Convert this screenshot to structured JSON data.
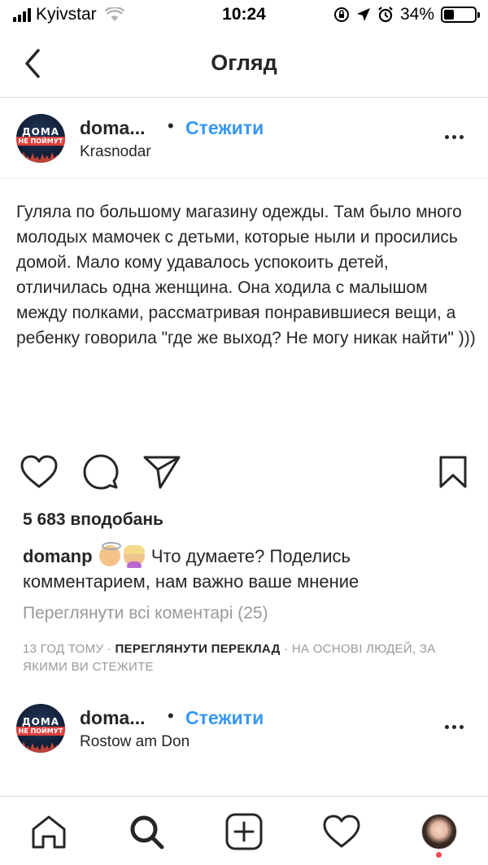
{
  "status_bar": {
    "carrier": "Kyivstar",
    "time": "10:24",
    "battery_percent": "34%",
    "battery_level": 0.34
  },
  "header": {
    "title": "Огляд",
    "back_icon": "chevron-left-icon"
  },
  "posts": [
    {
      "avatar_text_top": "ДОМА",
      "avatar_text_bottom": "НЕ ПОЙМУТ",
      "username": "doma...",
      "dot": "•",
      "follow_label": "Стежити",
      "location": "Krasnodar"
    },
    {
      "avatar_text_top": "ДОМА",
      "avatar_text_bottom": "НЕ ПОЙМУТ",
      "username": "doma...",
      "dot": "•",
      "follow_label": "Стежити",
      "location": "Rostow am Don"
    }
  ],
  "post_body": "Гуляла по большому магазину одежды. Там было много молодых мамочек с детьми, которые ныли и просились домой. Мало кому удавалось успокоить детей, отличилась одна женщина. Она ходила с малышом между полками, рассматривая понравившиеся вещи, а ребенку говорила \"где же выход? Не могу никак найти\" )))",
  "likes": "5 683 вподобань",
  "caption": {
    "username": "domanp",
    "text": "Что думаете? Поделись комментарием, нам важно ваше мнение"
  },
  "view_comments": "Переглянути всі коментарі (25)",
  "meta": {
    "time_ago": "13 год тому",
    "sep": "·",
    "see_translation": "Переглянути переклад",
    "suggested": "На основі людей, за якими ви стежите"
  },
  "actions": [
    "heart-icon",
    "comment-icon",
    "share-icon",
    "bookmark-icon"
  ],
  "tab_bar": [
    "home-icon",
    "search-icon",
    "add-post-icon",
    "activity-heart-icon",
    "profile-avatar"
  ],
  "colors": {
    "link_blue": "#3897f0",
    "text": "#262626",
    "muted": "#999999",
    "notif_red": "#ed4956"
  }
}
